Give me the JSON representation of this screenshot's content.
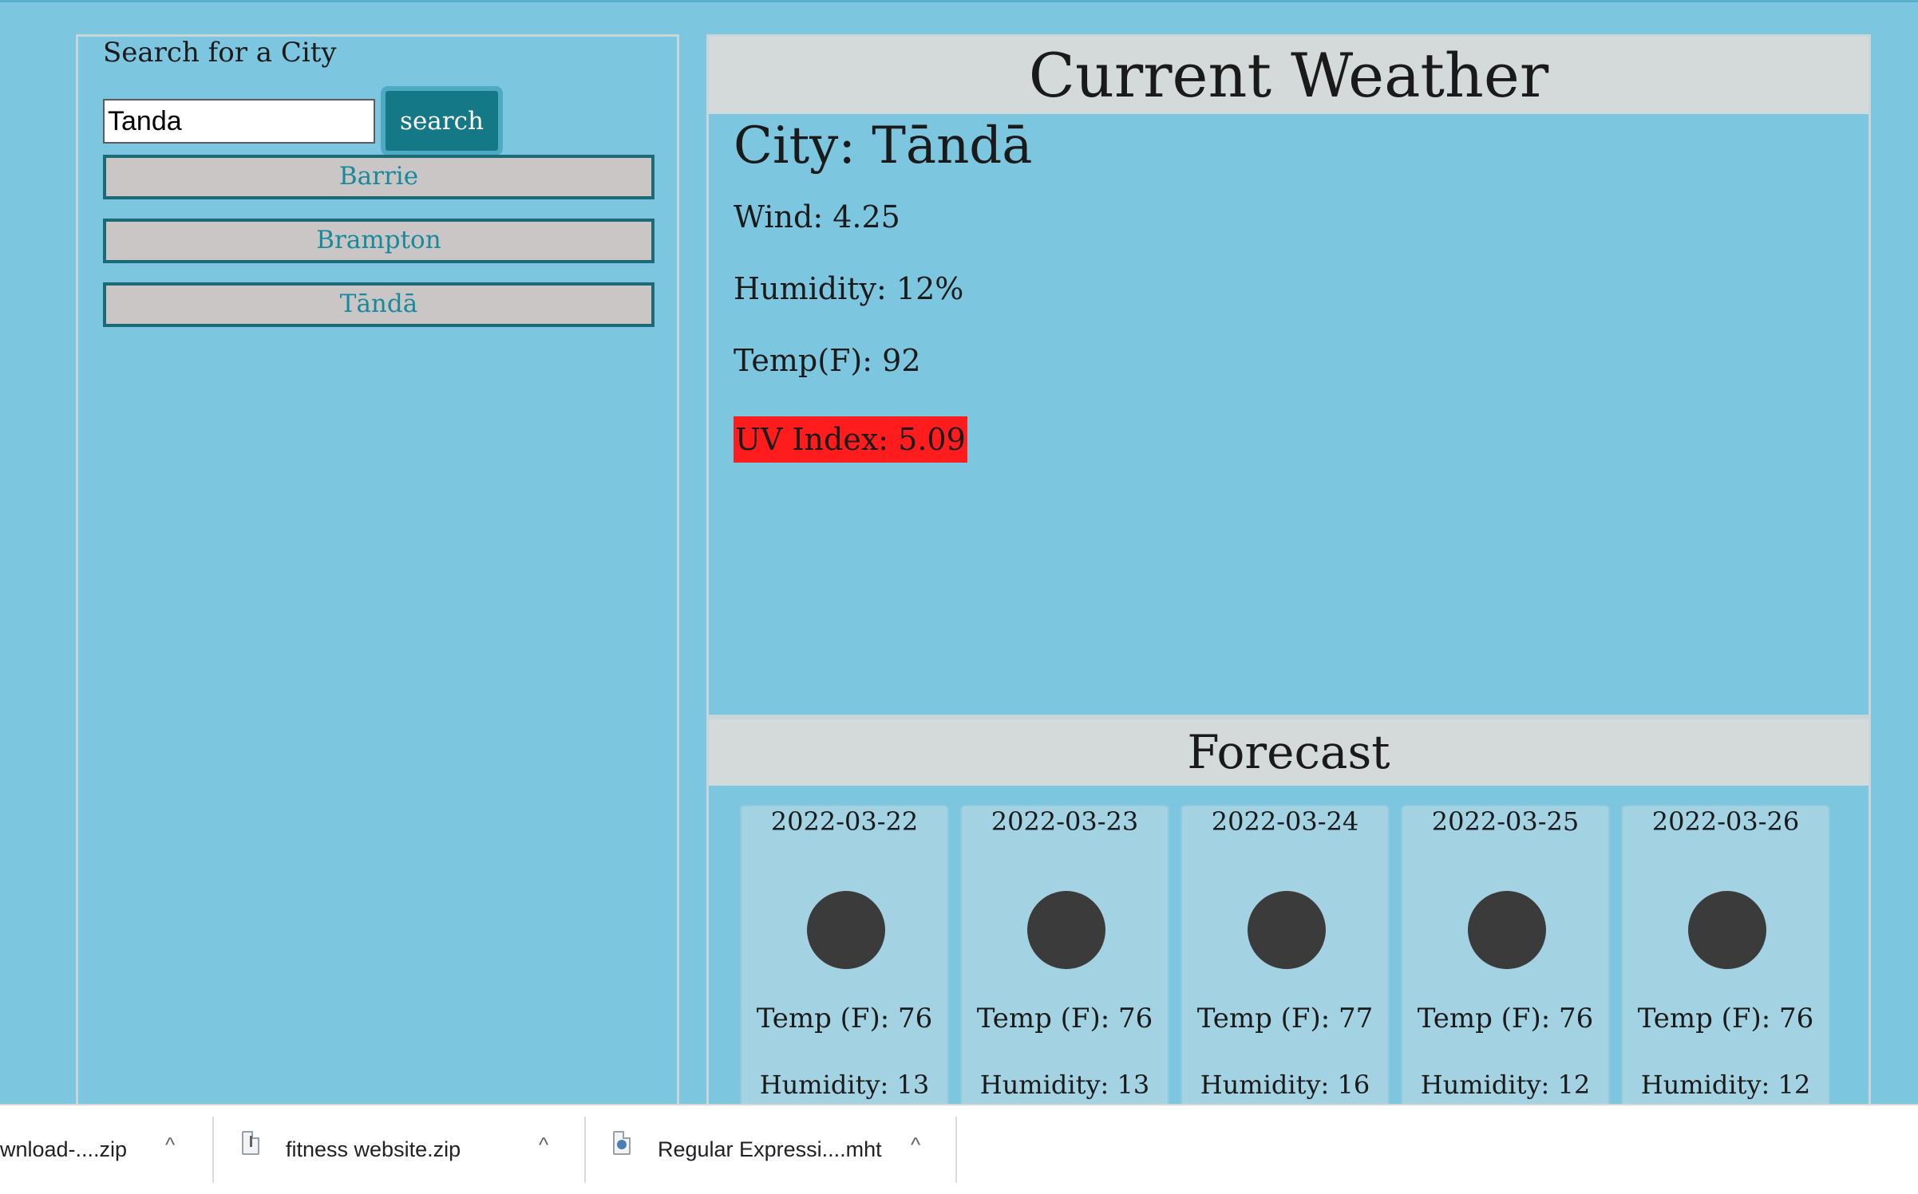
{
  "search": {
    "title": "Search for a City",
    "input_value": "Tanda",
    "button_label": "search",
    "history": [
      "Barrie",
      "Brampton",
      "Tāndā"
    ]
  },
  "current": {
    "heading": "Current Weather",
    "city_line": "City: Tāndā",
    "wind": "Wind: 4.25",
    "humidity": "Humidity: 12%",
    "temp": "Temp(F): 92",
    "uv": "UV Index: 5.09",
    "uv_color": "#ff1c1c"
  },
  "forecast": {
    "heading": "Forecast",
    "days": [
      {
        "date": "2022-03-22",
        "temp": "Temp (F): 76",
        "humidity": "Humidity: 13",
        "icon": "weather-icon"
      },
      {
        "date": "2022-03-23",
        "temp": "Temp (F): 76",
        "humidity": "Humidity: 13",
        "icon": "weather-icon"
      },
      {
        "date": "2022-03-24",
        "temp": "Temp (F): 77",
        "humidity": "Humidity: 16",
        "icon": "weather-icon"
      },
      {
        "date": "2022-03-25",
        "temp": "Temp (F): 76",
        "humidity": "Humidity: 12",
        "icon": "weather-icon"
      },
      {
        "date": "2022-03-26",
        "temp": "Temp (F): 76",
        "humidity": "Humidity: 12",
        "icon": "weather-icon"
      }
    ]
  },
  "downloads": {
    "items": [
      {
        "name": "wnload-....zip",
        "icon": "zip-file-icon"
      },
      {
        "name": "fitness website.zip",
        "icon": "zip-file-icon"
      },
      {
        "name": "Regular Expressi....mht",
        "icon": "mht-file-icon"
      }
    ],
    "caret": "^"
  },
  "colors": {
    "page_bg": "#7cc6df",
    "header_bg": "#d4d9da",
    "search_button": "#157887",
    "history_button_bg": "#cbc6c6",
    "history_text": "#178a9c",
    "card_bg": "#a3d3e3",
    "weather_icon": "#3b3b3b"
  }
}
